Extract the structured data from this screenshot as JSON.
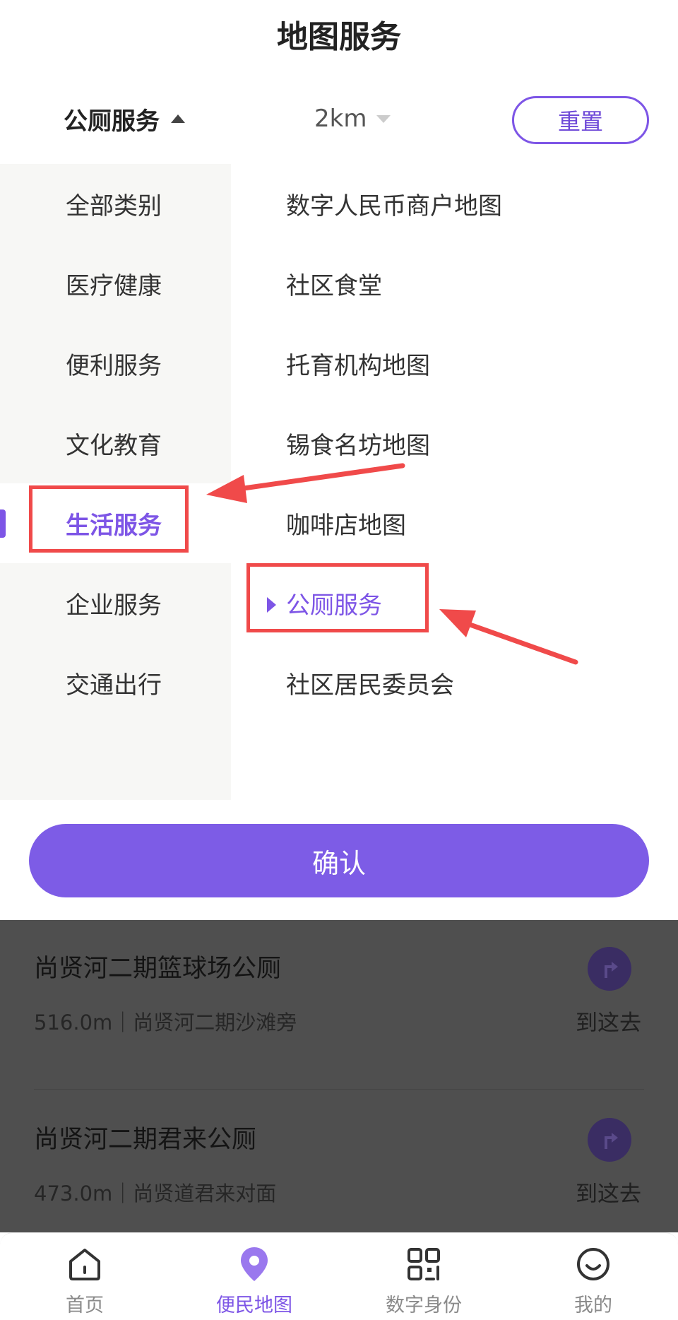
{
  "page": {
    "title": "地图服务"
  },
  "filter": {
    "category_label": "公厕服务",
    "distance_label": "2km",
    "reset_label": "重置"
  },
  "categories": [
    {
      "label": "全部类别",
      "active": false
    },
    {
      "label": "医疗健康",
      "active": false
    },
    {
      "label": "便利服务",
      "active": false
    },
    {
      "label": "文化教育",
      "active": false
    },
    {
      "label": "生活服务",
      "active": true
    },
    {
      "label": "企业服务",
      "active": false
    },
    {
      "label": "交通出行",
      "active": false
    }
  ],
  "subcategories": [
    {
      "label": "数字人民币商户地图",
      "active": false
    },
    {
      "label": "社区食堂",
      "active": false
    },
    {
      "label": "托育机构地图",
      "active": false
    },
    {
      "label": "锡食名坊地图",
      "active": false
    },
    {
      "label": "咖啡店地图",
      "active": false
    },
    {
      "label": "公厕服务",
      "active": true
    },
    {
      "label": "社区居民委员会",
      "active": false
    }
  ],
  "confirm_label": "确认",
  "results": [
    {
      "name": "尚贤河二期篮球场公厕",
      "meta": "516.0m｜尚贤河二期沙滩旁",
      "go_label": "到这去"
    },
    {
      "name": "尚贤河二期君来公厕",
      "meta": "473.0m｜尚贤道君来对面",
      "go_label": "到这去"
    }
  ],
  "tabs": [
    {
      "label": "首页",
      "icon": "home-icon",
      "active": false
    },
    {
      "label": "便民地图",
      "icon": "map-pin-icon",
      "active": true
    },
    {
      "label": "数字身份",
      "icon": "qr-code-icon",
      "active": false
    },
    {
      "label": "我的",
      "icon": "smiley-icon",
      "active": false
    }
  ],
  "colors": {
    "accent": "#7d55e6",
    "annotation": "#f04a4a",
    "overlay": "#4f4f4f"
  }
}
